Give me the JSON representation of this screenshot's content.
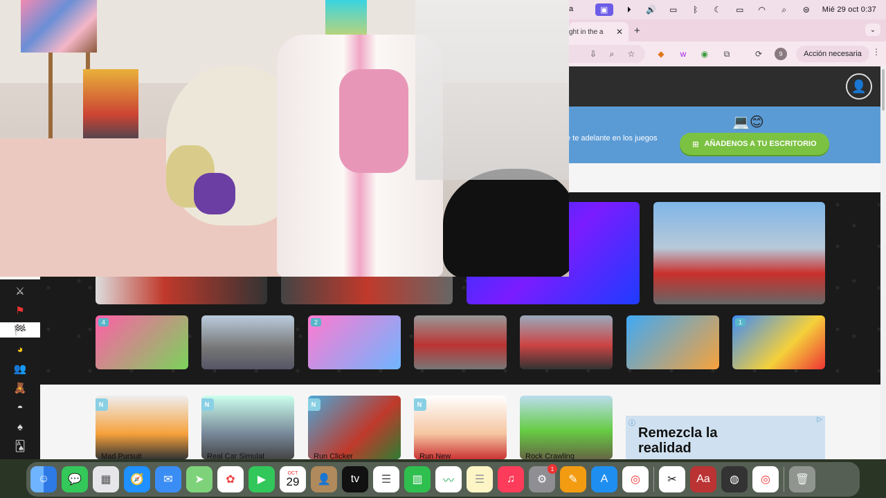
{
  "menubar": {
    "app_partial": "a",
    "clock": "Mié 29 oct 0:37",
    "icons": [
      "screen-record-icon",
      "play-icon",
      "volume-icon",
      "display-icon",
      "bluetooth-icon",
      "moon-icon",
      "battery-icon",
      "wifi-icon",
      "search-icon",
      "control-center-icon"
    ]
  },
  "browser": {
    "active_tab_title": "ght in the a",
    "new_tab": "+",
    "tab_menu": "⌄",
    "profile_initial": "9",
    "action_button": "Acción necesaria",
    "kebab": "⋮"
  },
  "page": {
    "promo_text": "e te adelante en los juegos",
    "add_desktop_label": "AÑADENOS A TU ESCRITORIO",
    "ad_title_line1": "Remezcla la",
    "ad_title_line2": "realidad",
    "games_row1": [
      {
        "badge": "4"
      },
      {
        "badge": ""
      },
      {
        "badge": "2"
      },
      {
        "badge": ""
      },
      {
        "badge": ""
      },
      {
        "badge": ""
      },
      {
        "badge": "1"
      }
    ],
    "new_games": [
      {
        "badge": "N",
        "title": "Mad Pursuit"
      },
      {
        "badge": "N",
        "title": "Real Car Simulat"
      },
      {
        "badge": "N",
        "title": "Run Clicker"
      },
      {
        "badge": "N",
        "title": "Run New"
      },
      {
        "badge": "",
        "title": "Rock Crawling"
      }
    ]
  },
  "sidebar_categories": [
    "swords-icon",
    "flag-icon",
    "racing-flag-icon",
    "pacman-icon",
    "two-players-icon",
    "bear-icon",
    "pokeball-icon",
    "spade-icon",
    "cards-icon"
  ],
  "dock": {
    "calendar_month": "OCT",
    "calendar_day": "29",
    "settings_badge": "1",
    "apps": [
      "finder",
      "messages",
      "launchpad",
      "safari",
      "mail",
      "maps",
      "photos",
      "facetime",
      "calendar",
      "contacts",
      "appletv",
      "reminders",
      "numbers",
      "freeform",
      "notes",
      "music",
      "system-settings",
      "pages",
      "app-store",
      "chrome",
      "capcut",
      "dictionary",
      "obs",
      "chrome-alt",
      "trash"
    ]
  }
}
